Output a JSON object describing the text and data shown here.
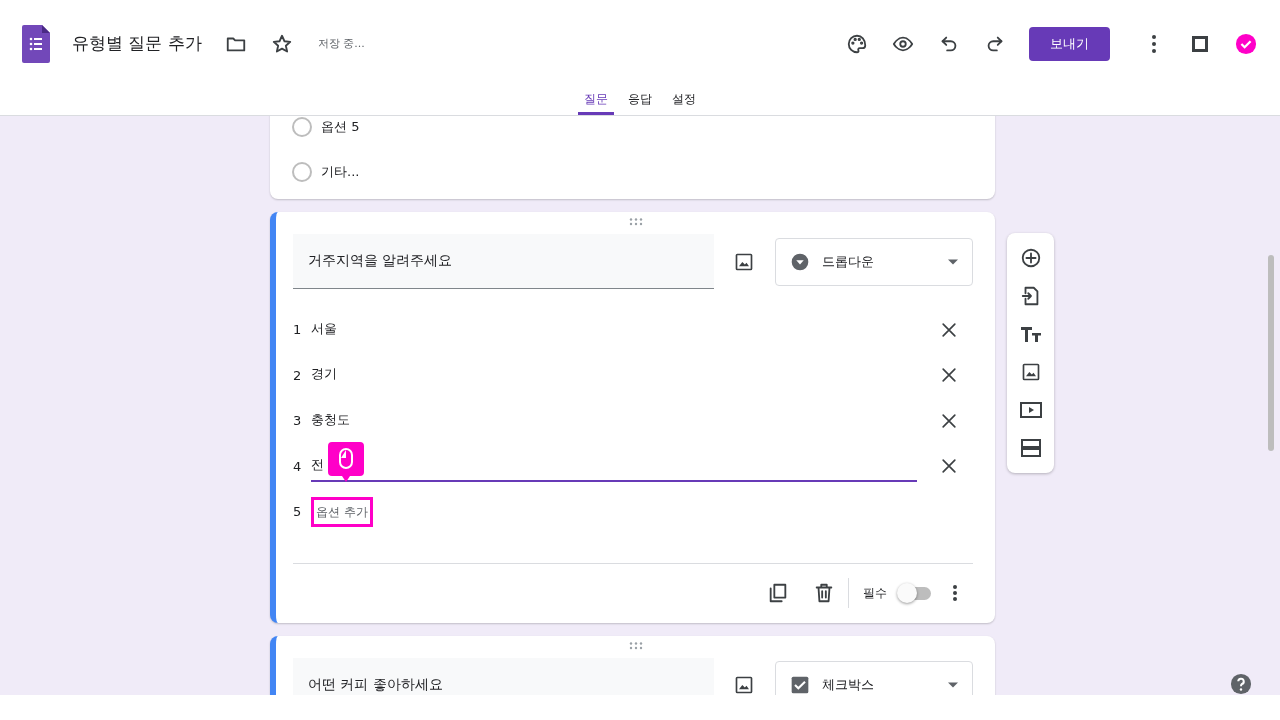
{
  "header": {
    "title": "유형별 질문 추가",
    "status": "저장 중...",
    "send_button": "보내기"
  },
  "tabs": [
    {
      "label": "질문",
      "selected": true
    },
    {
      "label": "응답",
      "selected": false
    },
    {
      "label": "설정",
      "selected": false
    }
  ],
  "previous_card": {
    "options": [
      {
        "label": "옵션 5",
        "selected": false
      },
      {
        "label": "기타...",
        "selected": false
      }
    ]
  },
  "question_cards": [
    {
      "selected": true,
      "title": "거주지역을 알려주세요",
      "type": {
        "kind": "dropdown",
        "label": "드롭다운"
      },
      "options": [
        {
          "number": "1",
          "label": "서울",
          "focused": false
        },
        {
          "number": "2",
          "label": "경기",
          "focused": false
        },
        {
          "number": "3",
          "label": "충청도",
          "focused": false
        },
        {
          "number": "4",
          "label": "전",
          "focused": true
        }
      ],
      "add_option": {
        "number": "5",
        "placeholder": "옵션 추가",
        "highlighted": true
      },
      "required": {
        "label": "필수",
        "on": false
      }
    },
    {
      "selected": true,
      "title": "어떤 커피 좋아하세요",
      "type": {
        "kind": "checkbox",
        "label": "체크박스"
      }
    }
  ]
}
